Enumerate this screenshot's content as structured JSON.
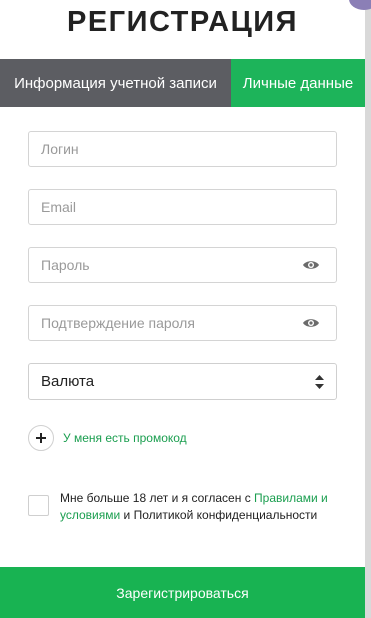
{
  "title": "РЕГИСТРАЦИЯ",
  "tabs": {
    "account": "Информация учетной записи",
    "personal": "Личные данные"
  },
  "fields": {
    "login_placeholder": "Логин",
    "email_placeholder": "Email",
    "password_placeholder": "Пароль",
    "confirm_placeholder": "Подтверждение пароля"
  },
  "currency": {
    "selected": "Валюта"
  },
  "promo": {
    "label": "У меня есть промокод"
  },
  "agreement": {
    "text_before": "Мне больше 18 лет и я согласен с ",
    "terms_link": "Правилами и условиями",
    "text_middle": " и ",
    "privacy": "Политикой конфиденциальности"
  },
  "submit_label": "Зарегистрироваться",
  "colors": {
    "accent_green": "#1db45a",
    "tab_dark": "#5c5d62",
    "link_green": "#1a9e4f"
  },
  "icons": [
    "eye-icon",
    "sort-arrows-icon",
    "plus-icon"
  ]
}
